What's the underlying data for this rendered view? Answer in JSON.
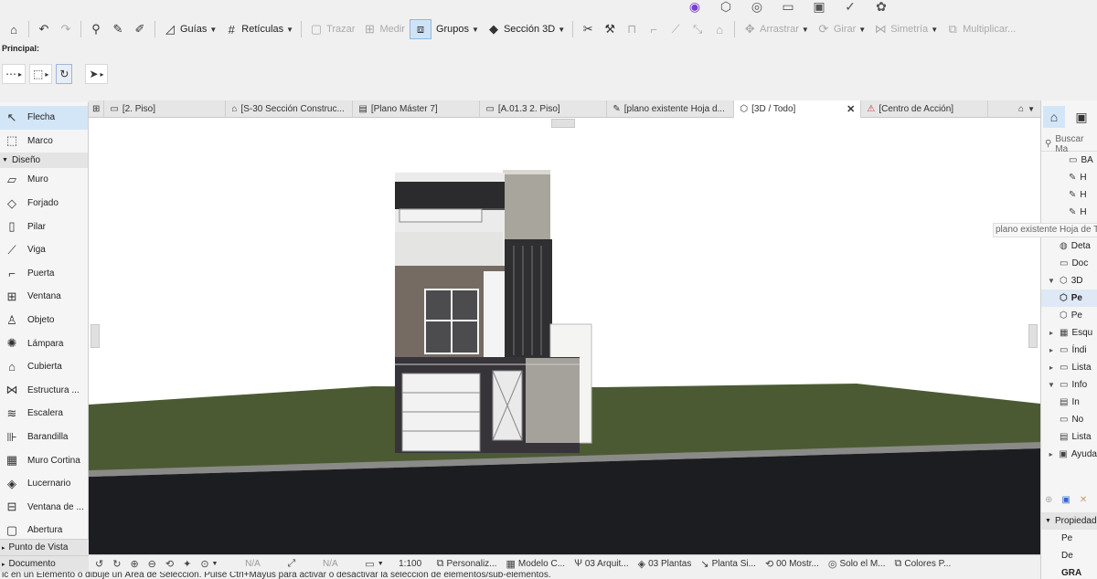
{
  "top_icons": [
    "app-icon",
    "cube-icon",
    "camera-icon",
    "window-icon",
    "photo-icon",
    "ar-icon",
    "cube-settings-icon"
  ],
  "toolbar": {
    "guides_label": "Guías",
    "grids_label": "Retículas",
    "trace_label": "Trazar",
    "measure_label": "Medir",
    "groups_label": "Grupos",
    "section3d_label": "Sección 3D",
    "drag_label": "Arrastrar",
    "rotate_label": "Girar",
    "mirror_label": "Simetría",
    "multiply_label": "Multiplicar..."
  },
  "principal_label": "Principal:",
  "tools": {
    "arrow": "Flecha",
    "marquee": "Marco",
    "design_section": "Diseño",
    "wall": "Muro",
    "slab": "Forjado",
    "column": "Pilar",
    "beam": "Viga",
    "door": "Puerta",
    "window": "Ventana",
    "object": "Objeto",
    "lamp": "Lámpara",
    "roof": "Cubierta",
    "structure": "Estructura ...",
    "stair": "Escalera",
    "railing": "Barandilla",
    "curtain_wall": "Muro Cortina",
    "skylight": "Lucernario",
    "corner_window": "Ventana de ...",
    "opening": "Abertura",
    "viewpoint_section": "Punto de Vista",
    "document_section": "Documento"
  },
  "tabs": [
    {
      "label": "[2. Piso]",
      "icon": "floor-plan-icon"
    },
    {
      "label": "[S-30 Sección Construc...",
      "icon": "section-icon"
    },
    {
      "label": "[Plano Máster 7]",
      "icon": "master-icon"
    },
    {
      "label": "[A.01.3 2. Piso]",
      "icon": "layout-icon"
    },
    {
      "label": "[plano existente Hoja d...",
      "icon": "worksheet-icon"
    },
    {
      "label": "[3D / Todo]",
      "icon": "3d-icon"
    },
    {
      "label": "[Centro de Acción]",
      "icon": "action-center-icon"
    }
  ],
  "status": {
    "na1": "N/A",
    "na2": "N/A",
    "scale": "1:100",
    "pen": "Personaliz...",
    "model": "Modelo C...",
    "arch": "03 Arquit...",
    "plans": "03 Plantas",
    "floor": "Planta Si...",
    "show": "00 Mostr...",
    "only": "Solo el M...",
    "colors": "Colores P..."
  },
  "hint_text": "ic en un Elemento o dibuje un Área de Selección. Pulse Ctrl+Mayús para activar o desactivar la selección de elementos/sub-elementos.",
  "navigator": {
    "search_placeholder": "Buscar Ma",
    "tooltip": "plano existente Hoja de Tra",
    "items": [
      "BA",
      "H",
      "H",
      "H",
      "Deta",
      "Doc",
      "3D",
      "Pe",
      "Pe",
      "Esqu",
      "Índi",
      "Lista",
      "Info",
      "In",
      "No",
      "Lista",
      "Ayuda"
    ],
    "props_label": "Propiedad",
    "pe_label": "Pe",
    "de_label": "De",
    "gra_label": "GRA"
  },
  "colors": {
    "selection_blue": "#d3e6f8",
    "ground_green": "#4b5a33",
    "dark_floor": "#1c1d20"
  }
}
